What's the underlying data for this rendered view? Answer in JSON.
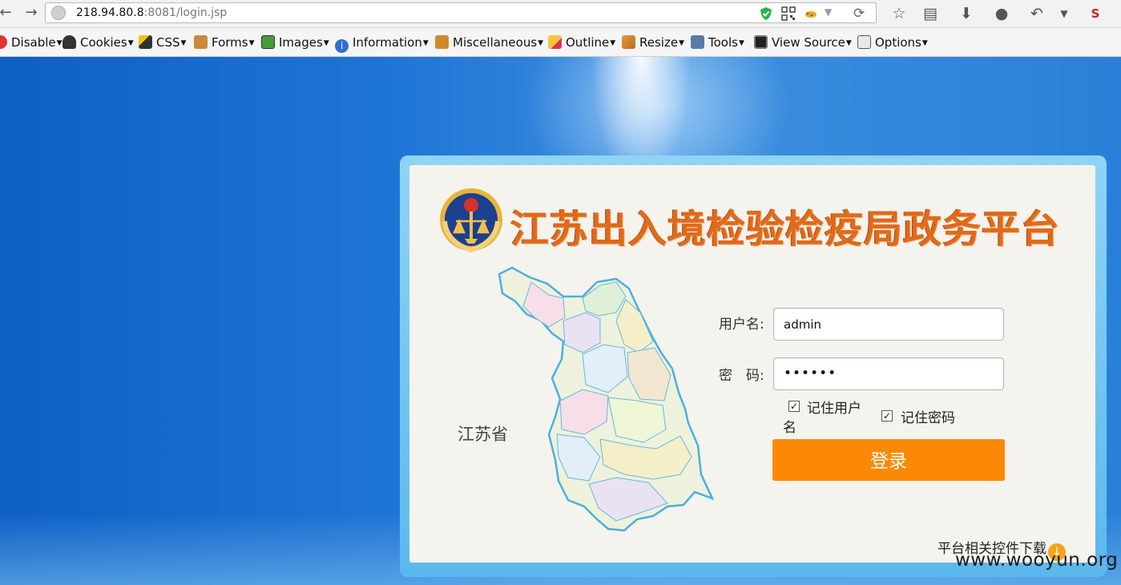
{
  "browser": {
    "url_host": "218.94.80.8",
    "url_rest": ":8081/login.jsp"
  },
  "extensions_bar": {
    "items": [
      {
        "label": "Disable",
        "icon": "disable-icon"
      },
      {
        "label": "Cookies",
        "icon": "cookies-icon"
      },
      {
        "label": "CSS",
        "icon": "css-wand-icon"
      },
      {
        "label": "Forms",
        "icon": "forms-clipboard-icon"
      },
      {
        "label": "Images",
        "icon": "images-icon"
      },
      {
        "label": "Information",
        "icon": "information-icon"
      },
      {
        "label": "Miscellaneous",
        "icon": "miscellaneous-icon"
      },
      {
        "label": "Outline",
        "icon": "outline-pencil-icon"
      },
      {
        "label": "Resize",
        "icon": "resize-ruler-icon"
      },
      {
        "label": "Tools",
        "icon": "tools-icon"
      },
      {
        "label": "View Source",
        "icon": "view-source-icon"
      },
      {
        "label": "Options",
        "icon": "options-icon"
      }
    ]
  },
  "login": {
    "title": "江苏出入境检验检疫局政务平台",
    "province_label": "江苏省",
    "username_label": "用户名:",
    "username_value": "admin",
    "password_label": "密　码:",
    "password_value": "••••••",
    "remember_user_line1": "记住用户",
    "remember_user_line2": "名",
    "remember_password": "记住密码",
    "remember_user_checked": true,
    "remember_password_checked": true,
    "submit_label": "登录",
    "download_link": "平台相关控件下载"
  },
  "watermark": "www.wooyun.org",
  "colors": {
    "login_button": "#fb8905",
    "title": "#e06a1a",
    "background": "#1b6fd0"
  }
}
